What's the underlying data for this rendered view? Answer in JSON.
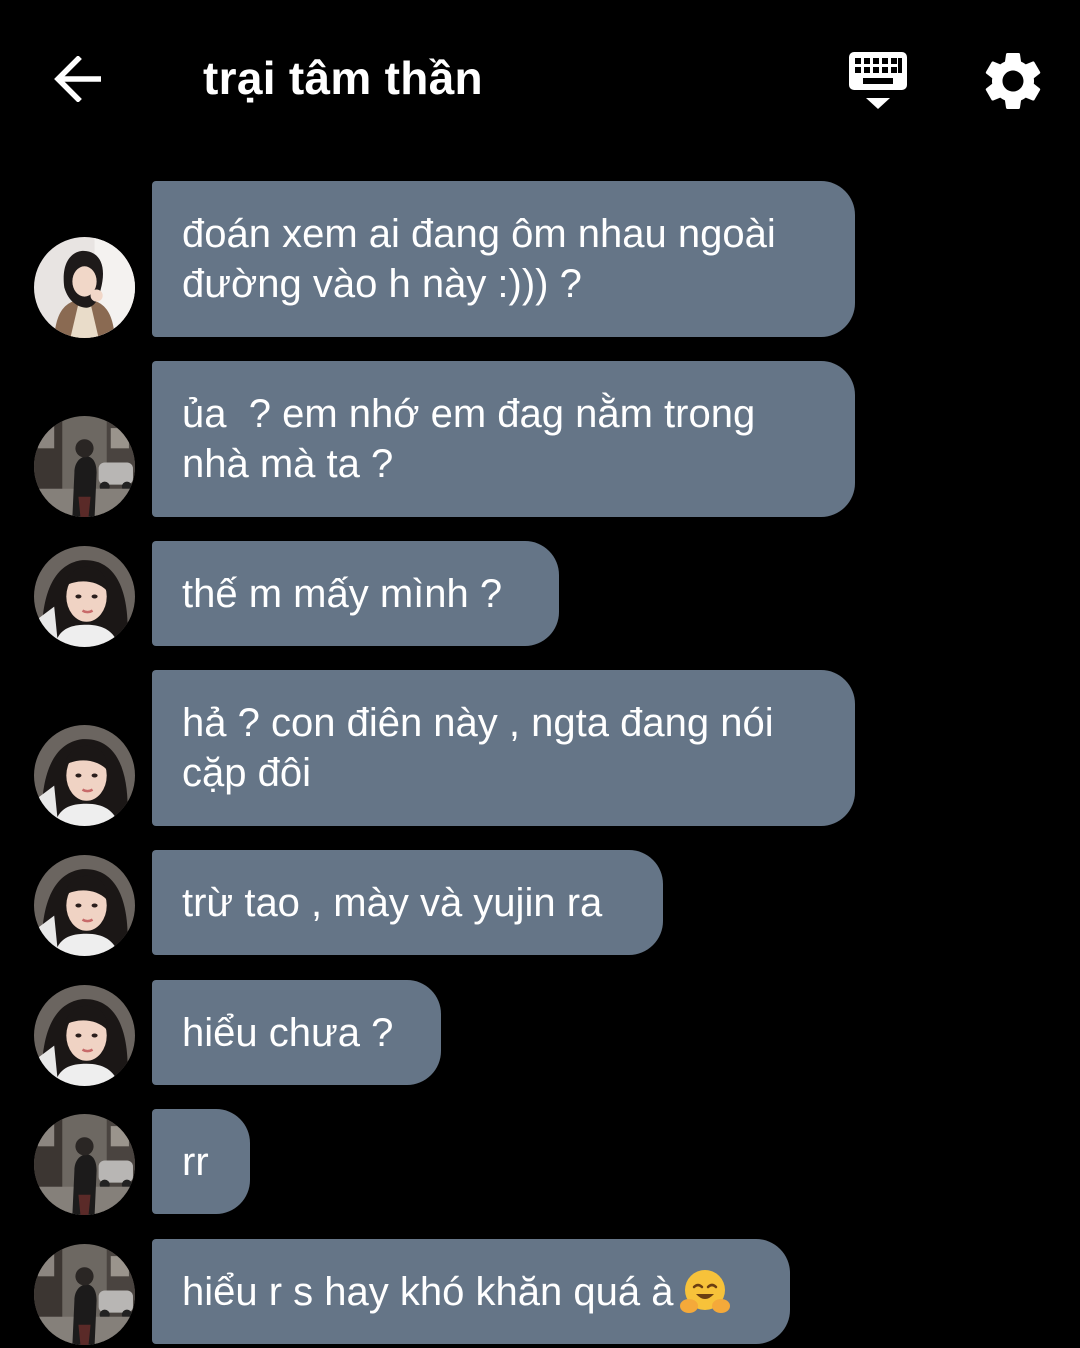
{
  "header": {
    "title": "trại tâm thần",
    "back_icon": "arrow-left-icon",
    "keyboard_icon": "keyboard-hide-icon",
    "settings_icon": "gear-icon"
  },
  "colors": {
    "background": "#000000",
    "bubble": "#657587",
    "text": "#ffffff"
  },
  "messages": [
    {
      "avatar": "avatar-girl-brown-coat",
      "text": "đoán xem ai đang ôm nhau ngoài\nđường vào h này :))) ?"
    },
    {
      "avatar": "avatar-street-photo",
      "text": "ủa  ? em nhớ em đag nằm trong\nnhà mà ta ?"
    },
    {
      "avatar": "avatar-girl-dark-hair",
      "text": "thế m mấy mình ?"
    },
    {
      "avatar": "avatar-girl-dark-hair",
      "text": "hả ? con điên này , ngta đang nói\ncặp đôi"
    },
    {
      "avatar": "avatar-girl-dark-hair",
      "text": "trừ tao , mày và yujin ra"
    },
    {
      "avatar": "avatar-girl-dark-hair",
      "text": "hiểu chưa ?"
    },
    {
      "avatar": "avatar-street-photo",
      "text": "rr"
    },
    {
      "avatar": "avatar-street-photo",
      "text": "hiểu r s hay khó khăn quá à",
      "emoji": "hugging-face-emoji"
    }
  ]
}
